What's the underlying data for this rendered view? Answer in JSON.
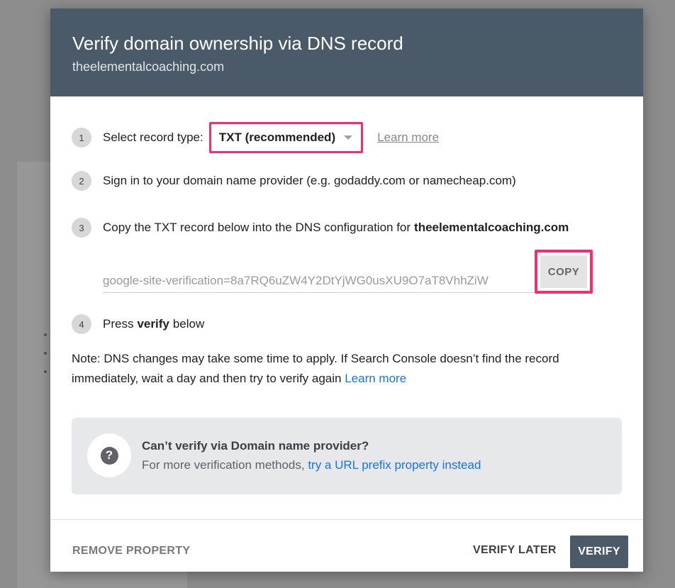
{
  "dialog": {
    "title": "Verify domain ownership via DNS record",
    "subtitle": "theelementalcoaching.com"
  },
  "steps": [
    {
      "number": "1",
      "label": "Select record type:",
      "select_value": "TXT (recommended)",
      "link": "Learn more"
    },
    {
      "number": "2",
      "text": "Sign in to your domain name provider (e.g. godaddy.com or namecheap.com)"
    },
    {
      "number": "3",
      "text": "Copy the TXT record below into the DNS configuration for",
      "domain": "theelementalcoaching.com"
    },
    {
      "number": "4",
      "text_before": "Press",
      "text_bold": "verify",
      "text_after": "below"
    }
  ],
  "txt_record": {
    "value": "google-site-verification=8a7RQ6uZW4Y2DtYjWG0usXU9O7aT8VhhZiW",
    "copy_label": "COPY"
  },
  "note": {
    "text": "Note: DNS changes may take some time to apply. If Search Console doesn’t find the record immediately, wait a day and then try to verify again",
    "link": "Learn more"
  },
  "info_card": {
    "icon": "help-icon",
    "title": "Can’t verify via Domain name provider?",
    "body": "For more verification methods,",
    "link": "try a URL prefix property instead"
  },
  "footer": {
    "remove_label": "REMOVE PROPERTY",
    "later_label": "VERIFY LATER",
    "verify_label": "VERIFY"
  },
  "colors": {
    "header_bg": "#4b5a68",
    "highlight": "#f0306e",
    "link": "#1a73e8"
  }
}
